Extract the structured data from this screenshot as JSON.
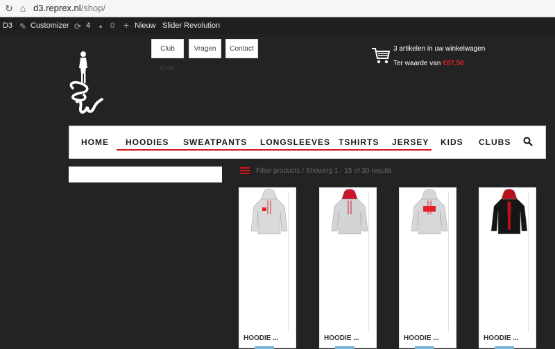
{
  "browser": {
    "host": "d3.reprex.nl",
    "path": "/shop/"
  },
  "adminbar": {
    "site": "D3",
    "customizer": "Customizer",
    "updates": "4",
    "comments": "0",
    "new": "Nieuw",
    "slider": "Slider Revolution"
  },
  "toplinks": [
    "Club Gear",
    "Vragen",
    "Contact"
  ],
  "cart": {
    "line1": "3 artikelen in uw winkelwagen",
    "line2_prefix": "Ter waarde van",
    "amount": "€87.50"
  },
  "nav": [
    "HOME",
    "HOODIES",
    "SWEATPANTS",
    "LONGSLEEVES",
    "TSHIRTS",
    "JERSEY",
    "KIDS",
    "CLUBS"
  ],
  "filter": "Filter products / Showing 1 - 15 of 30 results",
  "products": [
    {
      "name": "HOODIE ...",
      "body": "#d9dadc",
      "accent": "#e4202b"
    },
    {
      "name": "HOODIE ...",
      "body": "#d3d4d6",
      "accent": "#c8182a"
    },
    {
      "name": "HOODIE ...",
      "body": "#d6d7d9",
      "accent": "#e4202b"
    },
    {
      "name": "HOODIE ...",
      "body": "#151515",
      "accent": "#b5121b"
    }
  ],
  "colors": {
    "accent": "#d8151d",
    "background": "#232323"
  }
}
